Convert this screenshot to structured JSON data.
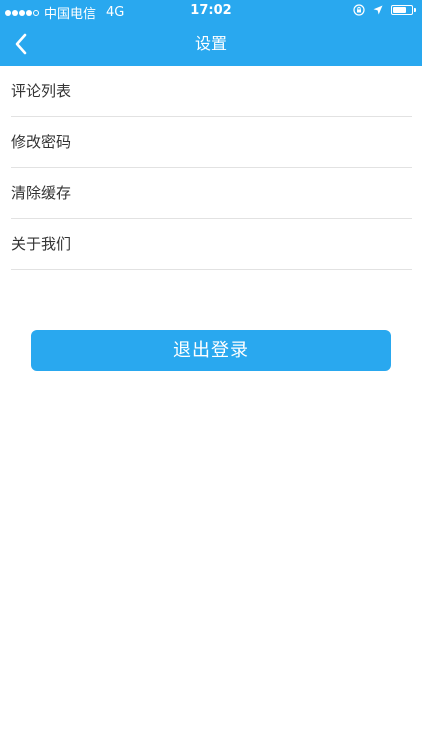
{
  "status_bar": {
    "carrier": "中国电信",
    "network": "4G",
    "time": "17:02",
    "battery_level": 0.7
  },
  "nav": {
    "title": "设置"
  },
  "menu": {
    "items": [
      {
        "label": "评论列表"
      },
      {
        "label": "修改密码"
      },
      {
        "label": "清除缓存"
      },
      {
        "label": "关于我们"
      }
    ]
  },
  "logout": {
    "label": "退出登录"
  },
  "colors": {
    "accent": "#29a8ef",
    "divider": "#e2e2e2",
    "text": "#333333"
  }
}
